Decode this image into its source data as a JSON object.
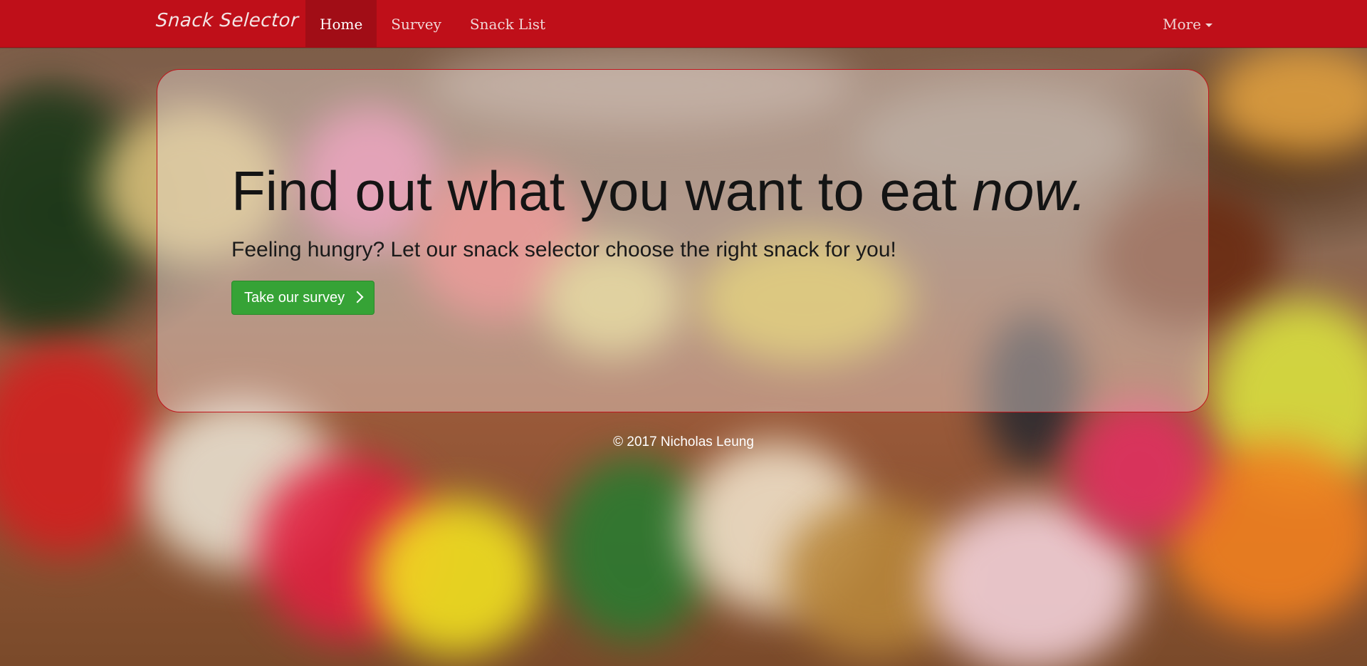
{
  "navbar": {
    "brand": "Snack Selector",
    "items": [
      {
        "label": "Home",
        "active": true
      },
      {
        "label": "Survey",
        "active": false
      },
      {
        "label": "Snack List",
        "active": false
      }
    ],
    "more_label": "More",
    "background_color": "#bf0f19"
  },
  "hero": {
    "headline": "Find out what you want to eat",
    "headline_emphasis": "now.",
    "lead": "Feeling hungry? Let our snack selector choose the right snack for you!",
    "button_label": "Take our survey",
    "button_color": "#36a336"
  },
  "footer": {
    "text": "© 2017 Nicholas Leung"
  }
}
